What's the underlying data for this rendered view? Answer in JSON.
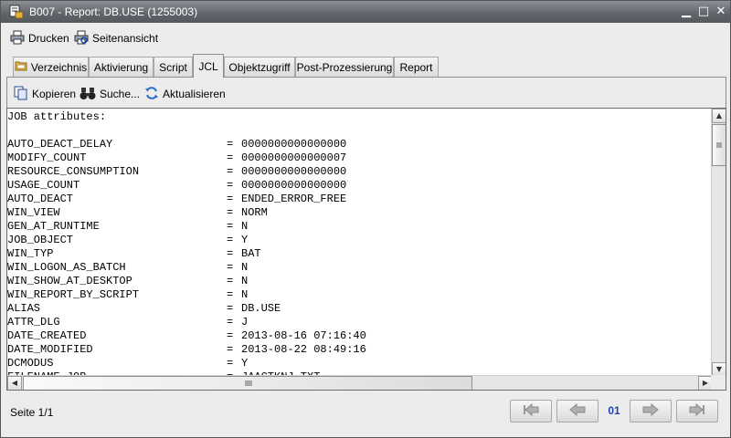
{
  "window": {
    "title": "B007 - Report: DB.USE (1255003)",
    "minimize_glyph": "▁",
    "maximize_glyph": "□",
    "close_glyph": "✕"
  },
  "toolbar": {
    "print_label": "Drucken",
    "preview_label": "Seitenansicht"
  },
  "tabs": [
    {
      "label": "Verzeichnis",
      "icon": "folder-icon"
    },
    {
      "label": "Aktivierung"
    },
    {
      "label": "Script"
    },
    {
      "label": "JCL",
      "active": true
    },
    {
      "label": "Objektzugriff"
    },
    {
      "label": "Post-Prozessierung"
    },
    {
      "label": "Report"
    }
  ],
  "subtoolbar": {
    "copy_label": "Kopieren",
    "search_label": "Suche...",
    "refresh_label": "Aktualisieren"
  },
  "report": {
    "header": "JOB attributes:",
    "lines": [
      {
        "key": "AUTO_DEACT_DELAY",
        "value": "0000000000000000"
      },
      {
        "key": "MODIFY_COUNT",
        "value": "0000000000000007"
      },
      {
        "key": "RESOURCE_CONSUMPTION",
        "value": "0000000000000000"
      },
      {
        "key": "USAGE_COUNT",
        "value": "0000000000000000"
      },
      {
        "key": "AUTO_DEACT",
        "value": "ENDED_ERROR_FREE"
      },
      {
        "key": "WIN_VIEW",
        "value": "NORM"
      },
      {
        "key": "GEN_AT_RUNTIME",
        "value": "N"
      },
      {
        "key": "JOB_OBJECT",
        "value": "Y"
      },
      {
        "key": "WIN_TYP",
        "value": "BAT"
      },
      {
        "key": "WIN_LOGON_AS_BATCH",
        "value": "N"
      },
      {
        "key": "WIN_SHOW_AT_DESKTOP",
        "value": "N"
      },
      {
        "key": "WIN_REPORT_BY_SCRIPT",
        "value": "N"
      },
      {
        "key": "ALIAS",
        "value": "DB.USE"
      },
      {
        "key": "ATTR_DLG",
        "value": "J"
      },
      {
        "key": "DATE_CREATED",
        "value": "2013-08-16 07:16:40"
      },
      {
        "key": "DATE_MODIFIED",
        "value": "2013-08-22 08:49:16"
      },
      {
        "key": "DCMODUS",
        "value": "Y"
      },
      {
        "key": "FILENAME_JOB",
        "value": "JAACTKNJ.TXT"
      }
    ],
    "separator": "="
  },
  "footer": {
    "page_label": "Seite 1/1",
    "page_number": "01"
  },
  "colors": {
    "titlebar": "#5f646a",
    "page_number": "#1f46a8"
  }
}
